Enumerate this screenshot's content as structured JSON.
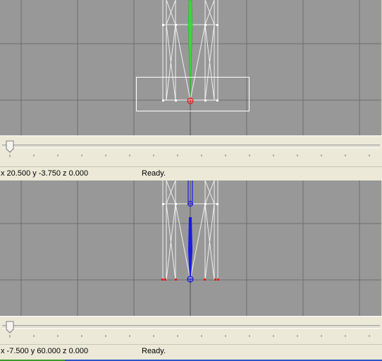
{
  "top_panel": {
    "status": {
      "coords": "x 20.500 y -3.750 z 0.000",
      "message": "Ready."
    },
    "timeline": {
      "position": 0.0
    }
  },
  "bottom_panel": {
    "status": {
      "coords": "x -7.500 y 60.000 z 0.000",
      "message": "Ready."
    },
    "timeline": {
      "position": 0.0
    }
  },
  "colors": {
    "viewport_bg": "#989898",
    "grid": "#6e6e6e",
    "wire": "#f0f0f0",
    "bone_green": "#3ed63e",
    "bone_blue": "#1a1ae6",
    "pivot_red": "#e02020",
    "selection_box": "#ffffff"
  }
}
